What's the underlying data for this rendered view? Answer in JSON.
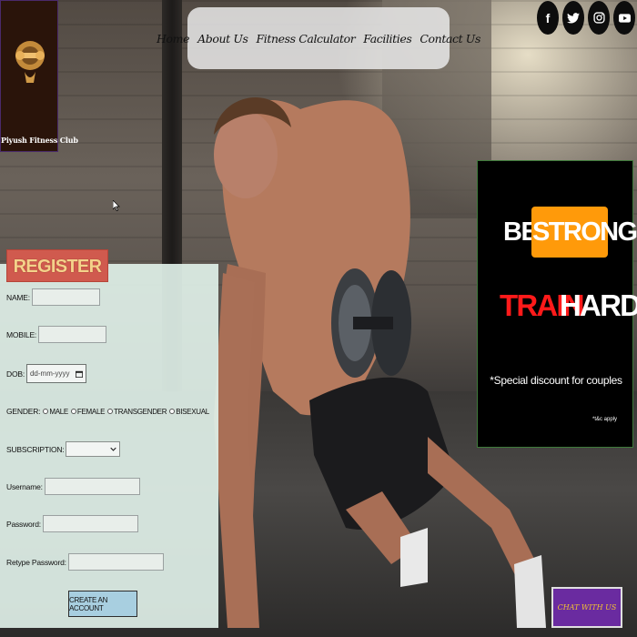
{
  "brand": {
    "name": "Piyush Fitness Club"
  },
  "nav": {
    "items": [
      "Home",
      "About Us",
      "Fitness Calculator",
      "Facilities",
      "Contact Us"
    ]
  },
  "social": {
    "icons": [
      "facebook-icon",
      "twitter-icon",
      "instagram-icon",
      "youtube-icon"
    ],
    "facebook_glyph": "f"
  },
  "promo": {
    "line1_word1": "BE",
    "line1_word2": "STRONG",
    "line2_word1": "TRAIN",
    "line2_word2": "HARD",
    "discount": "*Special discount for couples",
    "terms": "*t&c apply",
    "colors": {
      "accent_orange": "#ff9a0a",
      "accent_red": "#ff1a1a",
      "background": "#000000"
    }
  },
  "form": {
    "title": "REGISTER NOW",
    "name_label": "NAME:",
    "mobile_label": "MOBILE:",
    "dob_label": "DOB:",
    "dob_placeholder": "dd-mm-yyyy",
    "gender_label": "GENDER:",
    "gender_options": [
      "MALE",
      "FEMALE",
      "TRANSGENDER",
      "BISEXUAL"
    ],
    "subscription_label": "SUBSCRIPTION:",
    "subscription_value": "",
    "username_label": "Username:",
    "password_label": "Password:",
    "retype_label": "Retype Password:",
    "submit_label": "CREATE AN ACCOUNT"
  },
  "chat": {
    "label": "CHAT WITH US",
    "color": "#6a2ba0"
  }
}
